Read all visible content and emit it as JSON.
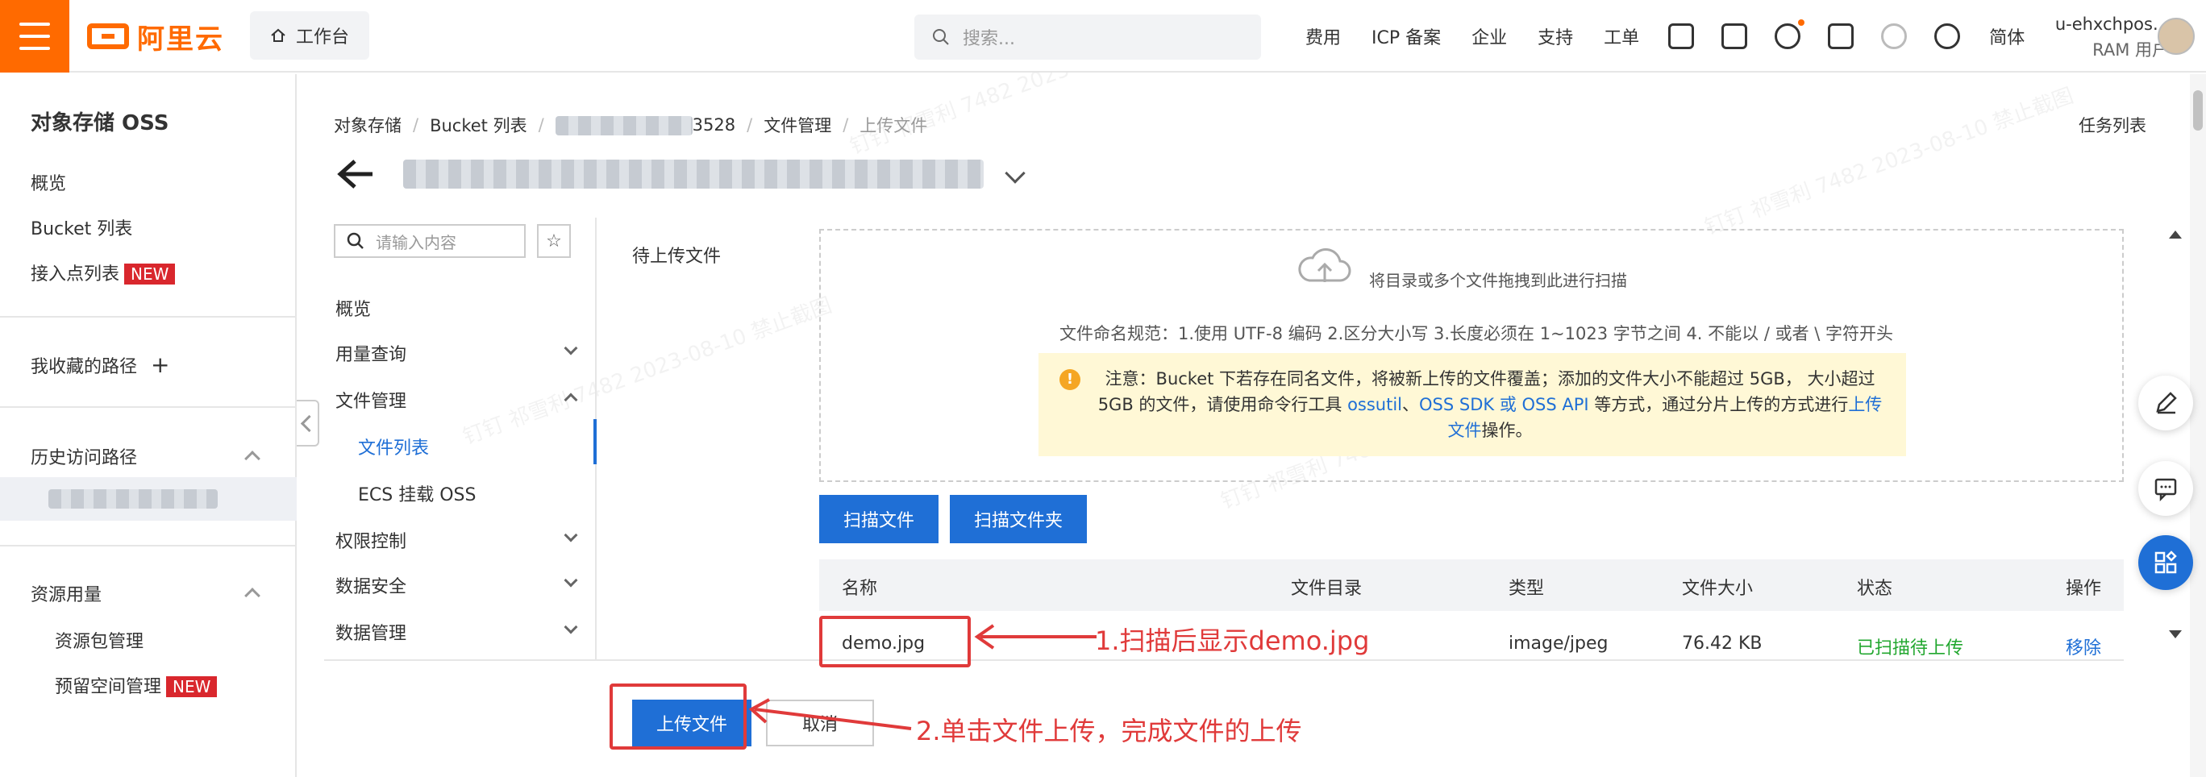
{
  "topbar": {
    "logo_text": "阿里云",
    "workbench": "工作台",
    "search_placeholder": "搜索...",
    "nav": [
      "费用",
      "ICP 备案",
      "企业",
      "支持",
      "工单"
    ],
    "lang": "简体",
    "user_name": "u-ehxchpos...",
    "user_role": "RAM 用户",
    "icons": [
      "grid-icon",
      "terminal-icon",
      "bell-icon",
      "cart-icon",
      "bulb-icon",
      "help-icon"
    ]
  },
  "sidebar": {
    "title": "对象存储 OSS",
    "overview": "概览",
    "bucket_list": "Bucket 列表",
    "access_points": "接入点列表",
    "badge_new": "NEW",
    "favorites": "我收藏的路径",
    "history": "历史访问路径",
    "resource_usage": "资源用量",
    "resource_pack": "资源包管理",
    "reserved_space": "预留空间管理"
  },
  "breadcrumb": [
    "对象存储",
    "Bucket 列表",
    "3528",
    "文件管理",
    "上传文件"
  ],
  "task_list": "任务列表",
  "leftnav": {
    "search_placeholder": "请输入内容",
    "items": {
      "overview": "概览",
      "usage": "用量查询",
      "file_mgmt": "文件管理",
      "file_list": "文件列表",
      "ecs_mount": "ECS 挂载 OSS",
      "permission": "权限控制",
      "data_security": "数据安全",
      "data_mgmt": "数据管理"
    }
  },
  "upload": {
    "pending_label": "待上传文件",
    "drop_hint": "将目录或多个文件拖拽到此进行扫描",
    "naming_rule": "文件命名规范：1.使用 UTF-8 编码 2.区分大小写 3.长度必须在 1~1023 字节之间 4. 不能以 / 或者 \\ 字符开头",
    "notice_line1": "注意：Bucket 下若存在同名文件，将被新上传的文件覆盖；添加的文件大小不能超过 5GB， 大小超过",
    "notice_line2_pre": "5GB 的文件，请使用命令行工具 ",
    "notice_link1": "ossutil",
    "notice_sep": "、",
    "notice_link2": "OSS SDK",
    "notice_or": " 或 ",
    "notice_link3": "OSS API",
    "notice_line2_post": " 等方式，通过分片上传的方式进行",
    "notice_link4": "上传",
    "notice_link5": "文件",
    "notice_line3_post": "操作。",
    "scan_files": "扫描文件",
    "scan_folder": "扫描文件夹"
  },
  "table": {
    "headers": [
      "名称",
      "文件目录",
      "类型",
      "文件大小",
      "状态",
      "操作"
    ],
    "rows": [
      {
        "name": "demo.jpg",
        "dir": "",
        "type": "image/jpeg",
        "size": "76.42 KB",
        "status": "已扫描待上传",
        "action": "移除"
      }
    ]
  },
  "footer": {
    "upload_btn": "上传文件",
    "cancel_btn": "取消"
  },
  "annotations": {
    "step1": "1.扫描后显示demo.jpg",
    "step2": "2.单击文件上传，完成文件的上传"
  },
  "colors": {
    "brand": "#ff6a00",
    "primary": "#1f6fd6",
    "annotation": "#e03a3a",
    "success": "#22a72f"
  }
}
